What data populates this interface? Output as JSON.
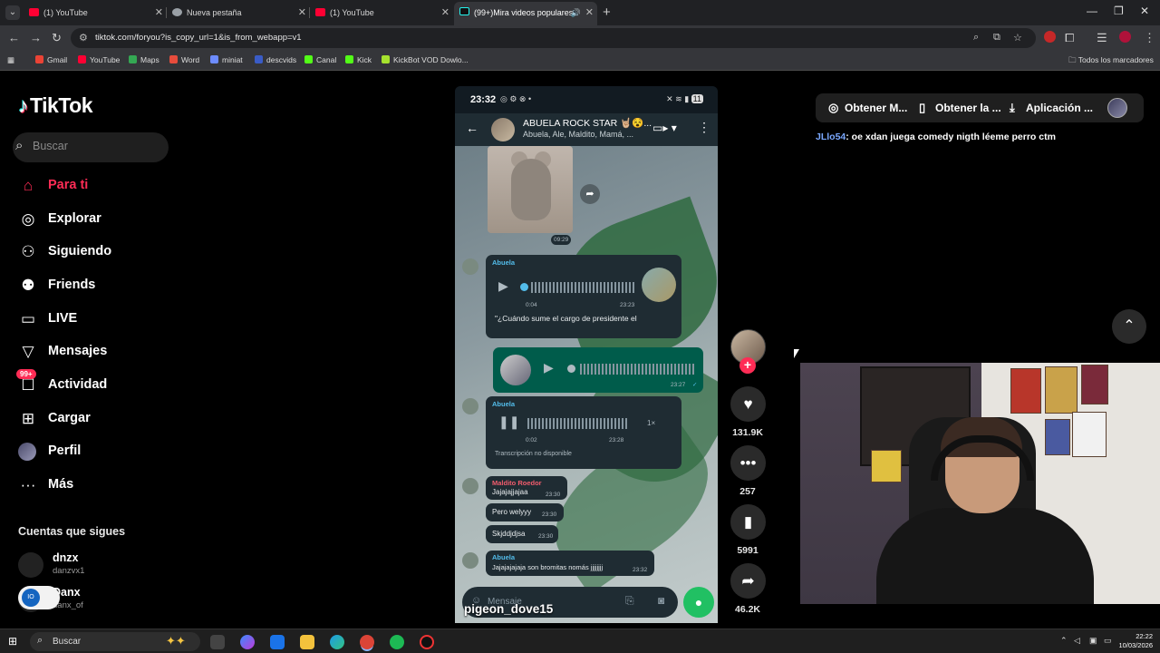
{
  "browser": {
    "tabs": [
      {
        "title": "(1) YouTube",
        "active": false
      },
      {
        "title": "Nueva pestaña",
        "active": false
      },
      {
        "title": "(1) YouTube",
        "active": false
      },
      {
        "title": "(99+)Mira videos populares",
        "active": true
      }
    ],
    "url": "tiktok.com/foryou?is_copy_url=1&is_from_webapp=v1",
    "bookmarks": [
      "Gmail",
      "YouTube",
      "Maps",
      "Word",
      "miniat",
      "descvids",
      "Canal",
      "Kick",
      "KickBot VOD Dowlo..."
    ],
    "all_bookmarks": "Todos los marcadores"
  },
  "sidebar": {
    "logo": "TikTok",
    "search_placeholder": "Buscar",
    "items": [
      {
        "label": "Para ti",
        "icon": "home-icon",
        "active": true
      },
      {
        "label": "Explorar",
        "icon": "compass-icon"
      },
      {
        "label": "Siguiendo",
        "icon": "following-icon"
      },
      {
        "label": "Friends",
        "icon": "friends-icon"
      },
      {
        "label": "LIVE",
        "icon": "live-icon"
      },
      {
        "label": "Mensajes",
        "icon": "message-icon"
      },
      {
        "label": "Actividad",
        "icon": "activity-icon",
        "badge": "99+"
      },
      {
        "label": "Cargar",
        "icon": "upload-icon"
      },
      {
        "label": "Perfil",
        "icon": "profile-avatar"
      },
      {
        "label": "Más",
        "icon": "more-icon"
      }
    ],
    "following_title": "Cuentas que sigues",
    "accounts": [
      {
        "name": "dnzx",
        "handle": "danzvx1"
      },
      {
        "name": "Danx",
        "handle": "danx_of"
      }
    ]
  },
  "video": {
    "status_time": "23:32",
    "battery": "11",
    "group_name": "ABUELA ROCK STAR 🤘🏼😵...",
    "group_members": "Abuela, Ale, Maldito, Mamá, ...",
    "image_time": "09:29",
    "voice1": {
      "sender": "Abuela",
      "duration": "0:04",
      "time": "23:23",
      "transcript": "\"¿Cuándo sume el cargo de presidente el"
    },
    "voice2": {
      "time": "23:27"
    },
    "voice3": {
      "sender": "Abuela",
      "speed": "1×",
      "duration": "0:02",
      "time": "23:28",
      "transcript": "Transcripción no disponible"
    },
    "messages": [
      {
        "sender": "Maldito Roedor",
        "text": "Jajajajjajaa",
        "time": "23:30"
      },
      {
        "text": "Pero welyyy",
        "time": "23:30"
      },
      {
        "text": "Skjddjdjsa",
        "time": "23:30"
      },
      {
        "sender": "Abuela",
        "text": "Jajajajajaja son bromitas nomás jjjjjjjj",
        "time": "23:32"
      }
    ],
    "input_placeholder": "Mensaje",
    "username": "pigeon_dove15"
  },
  "actions": {
    "likes": "131.9K",
    "comments": "257",
    "saves": "5991",
    "shares": "46.2K"
  },
  "top_right": {
    "btn1": "Obtener M...",
    "btn2": "Obtener la ...",
    "btn3": "Aplicación ..."
  },
  "chat_overlay": {
    "user": "JLlo54",
    "text": ": oe xdan juega comedy nigth léeme perro ctm"
  },
  "taskbar": {
    "search": "Buscar",
    "time": "22:22",
    "date": "10/03/2026"
  },
  "colors": {
    "tiktok_red": "#fe2c55",
    "whatsapp_green": "#21c063"
  }
}
